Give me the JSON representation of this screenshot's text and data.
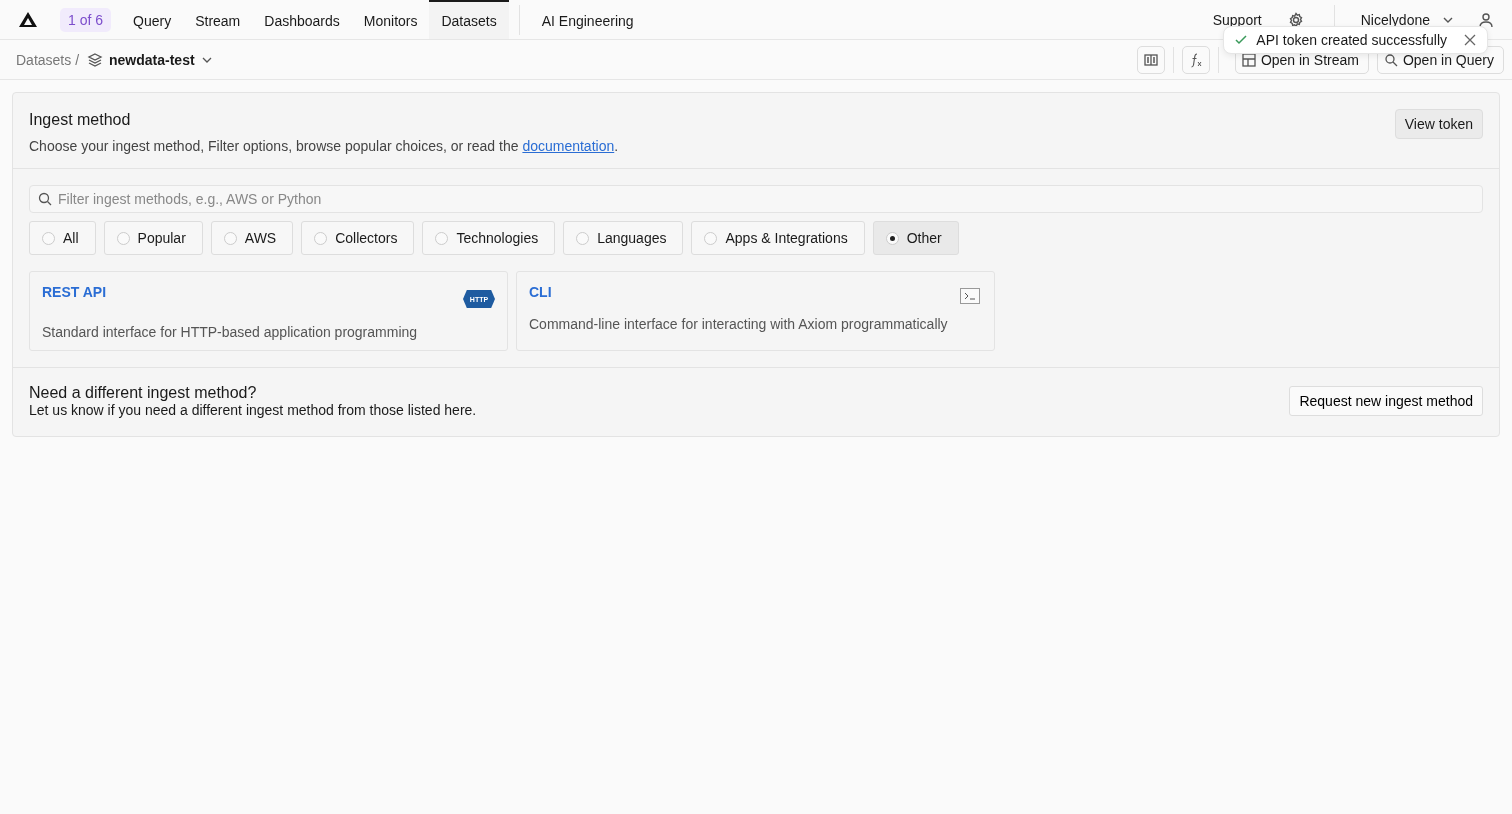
{
  "nav": {
    "badge": "1 of 6",
    "items": [
      {
        "label": "Query",
        "selected": false
      },
      {
        "label": "Stream",
        "selected": false
      },
      {
        "label": "Dashboards",
        "selected": false
      },
      {
        "label": "Monitors",
        "selected": false
      },
      {
        "label": "Datasets",
        "selected": true
      },
      {
        "label": "AI Engineering",
        "selected": false
      }
    ],
    "support": "Support",
    "user": "Nicelydone"
  },
  "breadcrumb": {
    "root": "Datasets /",
    "dataset": "newdata-test"
  },
  "toolbar": {
    "buttons": [
      "Open in Stream",
      "Open in Query"
    ]
  },
  "toast": {
    "message": "API token created successfully"
  },
  "ingest": {
    "title": "Ingest method",
    "description": "Choose your ingest method, Filter options, browse popular choices, or read the ",
    "link": "documentation",
    "after_link": ".",
    "view_token": "View token",
    "search": {
      "placeholder": "Filter ingest methods, e.g., AWS or Python"
    },
    "filters": [
      {
        "label": "All",
        "selected": false
      },
      {
        "label": "Popular",
        "selected": false
      },
      {
        "label": "AWS",
        "selected": false
      },
      {
        "label": "Collectors",
        "selected": false
      },
      {
        "label": "Technologies",
        "selected": false
      },
      {
        "label": "Languages",
        "selected": false
      },
      {
        "label": "Apps & Integrations",
        "selected": false
      },
      {
        "label": "Other",
        "selected": true
      }
    ],
    "methods": [
      {
        "title": "REST API",
        "kind": "http",
        "badge": "HTTP",
        "description": "Standard interface for HTTP-based application programming"
      },
      {
        "title": "CLI",
        "kind": "terminal",
        "description": "Command-line interface for interacting with Axiom programmatically"
      }
    ]
  },
  "request": {
    "title": "Need a different ingest method?",
    "text": "Let us know if you need a different ingest method from those listed here.",
    "button": "Request new ingest method"
  }
}
